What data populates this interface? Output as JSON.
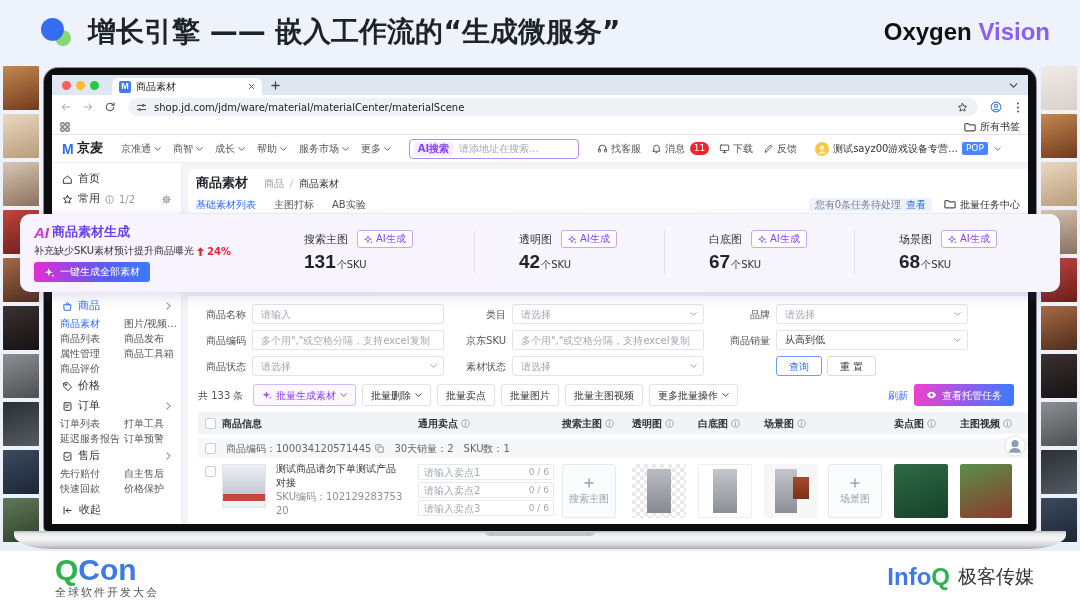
{
  "header": {
    "title": "增长引擎 —— 嵌入工作流的“生成微服务”",
    "brand": [
      "Oxygen",
      "Vision"
    ]
  },
  "browser": {
    "tabs": [
      {
        "icon_letter": "M",
        "title": "商品素材",
        "selected": true
      }
    ],
    "url": "shop.jd.com/jdm/ware/material/materialCenter/materialScene",
    "bookmarks_folder": "所有书签"
  },
  "app_header": {
    "logo_letter": "M",
    "logo_text": "京麦",
    "nav": [
      "京准通",
      "商智",
      "成长",
      "帮助",
      "服务市场",
      "更多"
    ],
    "search": {
      "label": "AI搜索",
      "placeholder": "请添地址在搜索..."
    },
    "actions": [
      {
        "kind": "headset",
        "label": "找客服"
      },
      {
        "kind": "bell",
        "label": "消息",
        "badge": "11"
      },
      {
        "kind": "monitor",
        "label": "下载"
      },
      {
        "kind": "pen",
        "label": "反馈"
      }
    ],
    "account": {
      "name": "测试sayz00游戏设备专营...",
      "tag": "POP"
    }
  },
  "sidebar": {
    "items": [
      {
        "kind": "home",
        "label": "首页",
        "selected": false
      },
      {
        "kind": "star",
        "label": "常用",
        "count": "1/2",
        "selected": false
      },
      {
        "kind": "bag",
        "label": "商品",
        "selected": true,
        "children": [
          {
            "label": "商品素材",
            "selected": true
          },
          {
            "label": "图片/视频...",
            "selected": false
          },
          {
            "label": "商品列表",
            "selected": false
          },
          {
            "label": "商品发布",
            "selected": false
          },
          {
            "label": "属性管理",
            "selected": false
          },
          {
            "label": "商品工具箱",
            "selected": false
          },
          {
            "label": "商品评价",
            "selected": false
          }
        ]
      },
      {
        "kind": "price",
        "label": "价格",
        "selected": false
      },
      {
        "kind": "order",
        "label": "订单",
        "selected": false,
        "children": [
          {
            "label": "订单列表",
            "selected": false
          },
          {
            "label": "打单工具",
            "selected": false
          },
          {
            "label": "延迟服务报告",
            "selected": false
          },
          {
            "label": "订单预警",
            "selected": false
          }
        ]
      },
      {
        "kind": "service",
        "label": "售后",
        "selected": false,
        "children": [
          {
            "label": "先行赔付",
            "selected": false
          },
          {
            "label": "自主售后",
            "selected": false
          },
          {
            "label": "快速回款",
            "selected": false
          },
          {
            "label": "价格保护",
            "selected": false
          }
        ]
      }
    ],
    "collapse": "收起"
  },
  "page": {
    "title": "商品素材",
    "breadcrumb": [
      "商品",
      "商品素材"
    ],
    "tabs": [
      {
        "label": "基础素材列表",
        "selected": true
      },
      {
        "label": "主图打标",
        "selected": false
      },
      {
        "label": "AB实验",
        "selected": false
      }
    ],
    "task_notice": "您有0条任务待处理",
    "task_link": "查看",
    "task_center": "批量任务中心"
  },
  "filters": [
    [
      {
        "label": "商品名称",
        "kind": "input",
        "placeholder": "请输入"
      },
      {
        "label": "类目",
        "kind": "select",
        "placeholder": "请选择"
      },
      {
        "label": "品牌",
        "kind": "select",
        "placeholder": "请选择"
      }
    ],
    [
      {
        "label": "商品编码",
        "kind": "input",
        "placeholder": "多个用\",\"或空格分隔，支持excel复制"
      },
      {
        "label": "京东SKU",
        "kind": "input",
        "placeholder": "多个用\",\"或空格分隔，支持excel复制"
      },
      {
        "label": "商品销量",
        "kind": "select",
        "value": "从高到低"
      }
    ],
    [
      {
        "label": "商品状态",
        "kind": "select",
        "placeholder": "请选择"
      },
      {
        "label": "素材状态",
        "kind": "select",
        "placeholder": "请选择"
      }
    ]
  ],
  "filter_buttons": [
    {
      "kind": "primary",
      "label": "查询"
    },
    {
      "kind": "default",
      "label": "重 置"
    }
  ],
  "toolbar": {
    "total": "共 133 条",
    "actions": [
      {
        "kind": "ai",
        "label": "批量生成素材",
        "dropdown": true
      },
      {
        "kind": "default",
        "label": "批量删除",
        "dropdown": true
      },
      {
        "kind": "default",
        "label": "批量卖点",
        "dropdown": false
      },
      {
        "kind": "default",
        "label": "批量图片",
        "dropdown": false
      },
      {
        "kind": "default",
        "label": "批量主图视频",
        "dropdown": false
      },
      {
        "kind": "default",
        "label": "更多批量操作",
        "dropdown": true
      }
    ],
    "refresh": "刷新",
    "primary": "查看托管任务"
  },
  "table": {
    "header_checked": false,
    "columns": [
      {
        "label": "商品信息",
        "kind": "plain"
      },
      {
        "label": "通用卖点",
        "kind": "help"
      },
      {
        "label": "搜索主图",
        "kind": "help"
      },
      {
        "label": "透明图",
        "kind": "help"
      },
      {
        "label": "白底图",
        "kind": "help"
      },
      {
        "label": "场景图",
        "kind": "help"
      },
      {
        "label": "卖点图",
        "kind": "help"
      },
      {
        "label": "主图视频",
        "kind": "help"
      }
    ],
    "groups": [
      {
        "checked": false,
        "code": "商品编码：100034120571445",
        "sales": "30天销量：2",
        "sku_count": "SKU数：1",
        "rows": [
          {
            "checked": false,
            "title": "测试商品请勿下单测试产品对接",
            "sku": "SKU编码：10212928375320",
            "sellpoints": [
              {
                "placeholder": "请输入卖点1",
                "count": "0 / 6"
              },
              {
                "placeholder": "请输入卖点2",
                "count": "0 / 6"
              },
              {
                "placeholder": "请输入卖点3",
                "count": "0 / 6"
              }
            ],
            "media": [
              [
                {
                  "kind": "upload",
                  "label": "搜索主图"
                }
              ],
              [
                {
                  "kind": "photo"
                }
              ],
              [
                {
                  "kind": "photo"
                }
              ],
              [
                {
                  "kind": "photo"
                },
                {
                  "kind": "upload",
                  "label": "场景图"
                }
              ],
              [
                {
                  "kind": "photo"
                }
              ],
              [
                {
                  "kind": "photo"
                }
              ]
            ]
          }
        ]
      }
    ]
  },
  "ai_card": {
    "logo": "AI",
    "title": "商品素材生成",
    "subtitle": "补充缺少SKU素材预计提升商品曝光",
    "uplift": "24%",
    "button": "一键生成全部素材",
    "stats": [
      {
        "label": "搜索主图",
        "badge": "AI生成",
        "value": "131",
        "unit": "个SKU"
      },
      {
        "label": "透明图",
        "badge": "AI生成",
        "value": "42",
        "unit": "个SKU"
      },
      {
        "label": "白底图",
        "badge": "AI生成",
        "value": "67",
        "unit": "个SKU"
      },
      {
        "label": "场景图",
        "badge": "AI生成",
        "value": "68",
        "unit": "个SKU"
      }
    ]
  },
  "footer": {
    "left": {
      "logo": [
        "Q",
        "Con"
      ],
      "tagline": "全球软件开发大会"
    },
    "right": {
      "logo": [
        "Info",
        "Q"
      ],
      "tagline": "极客传媒"
    }
  }
}
